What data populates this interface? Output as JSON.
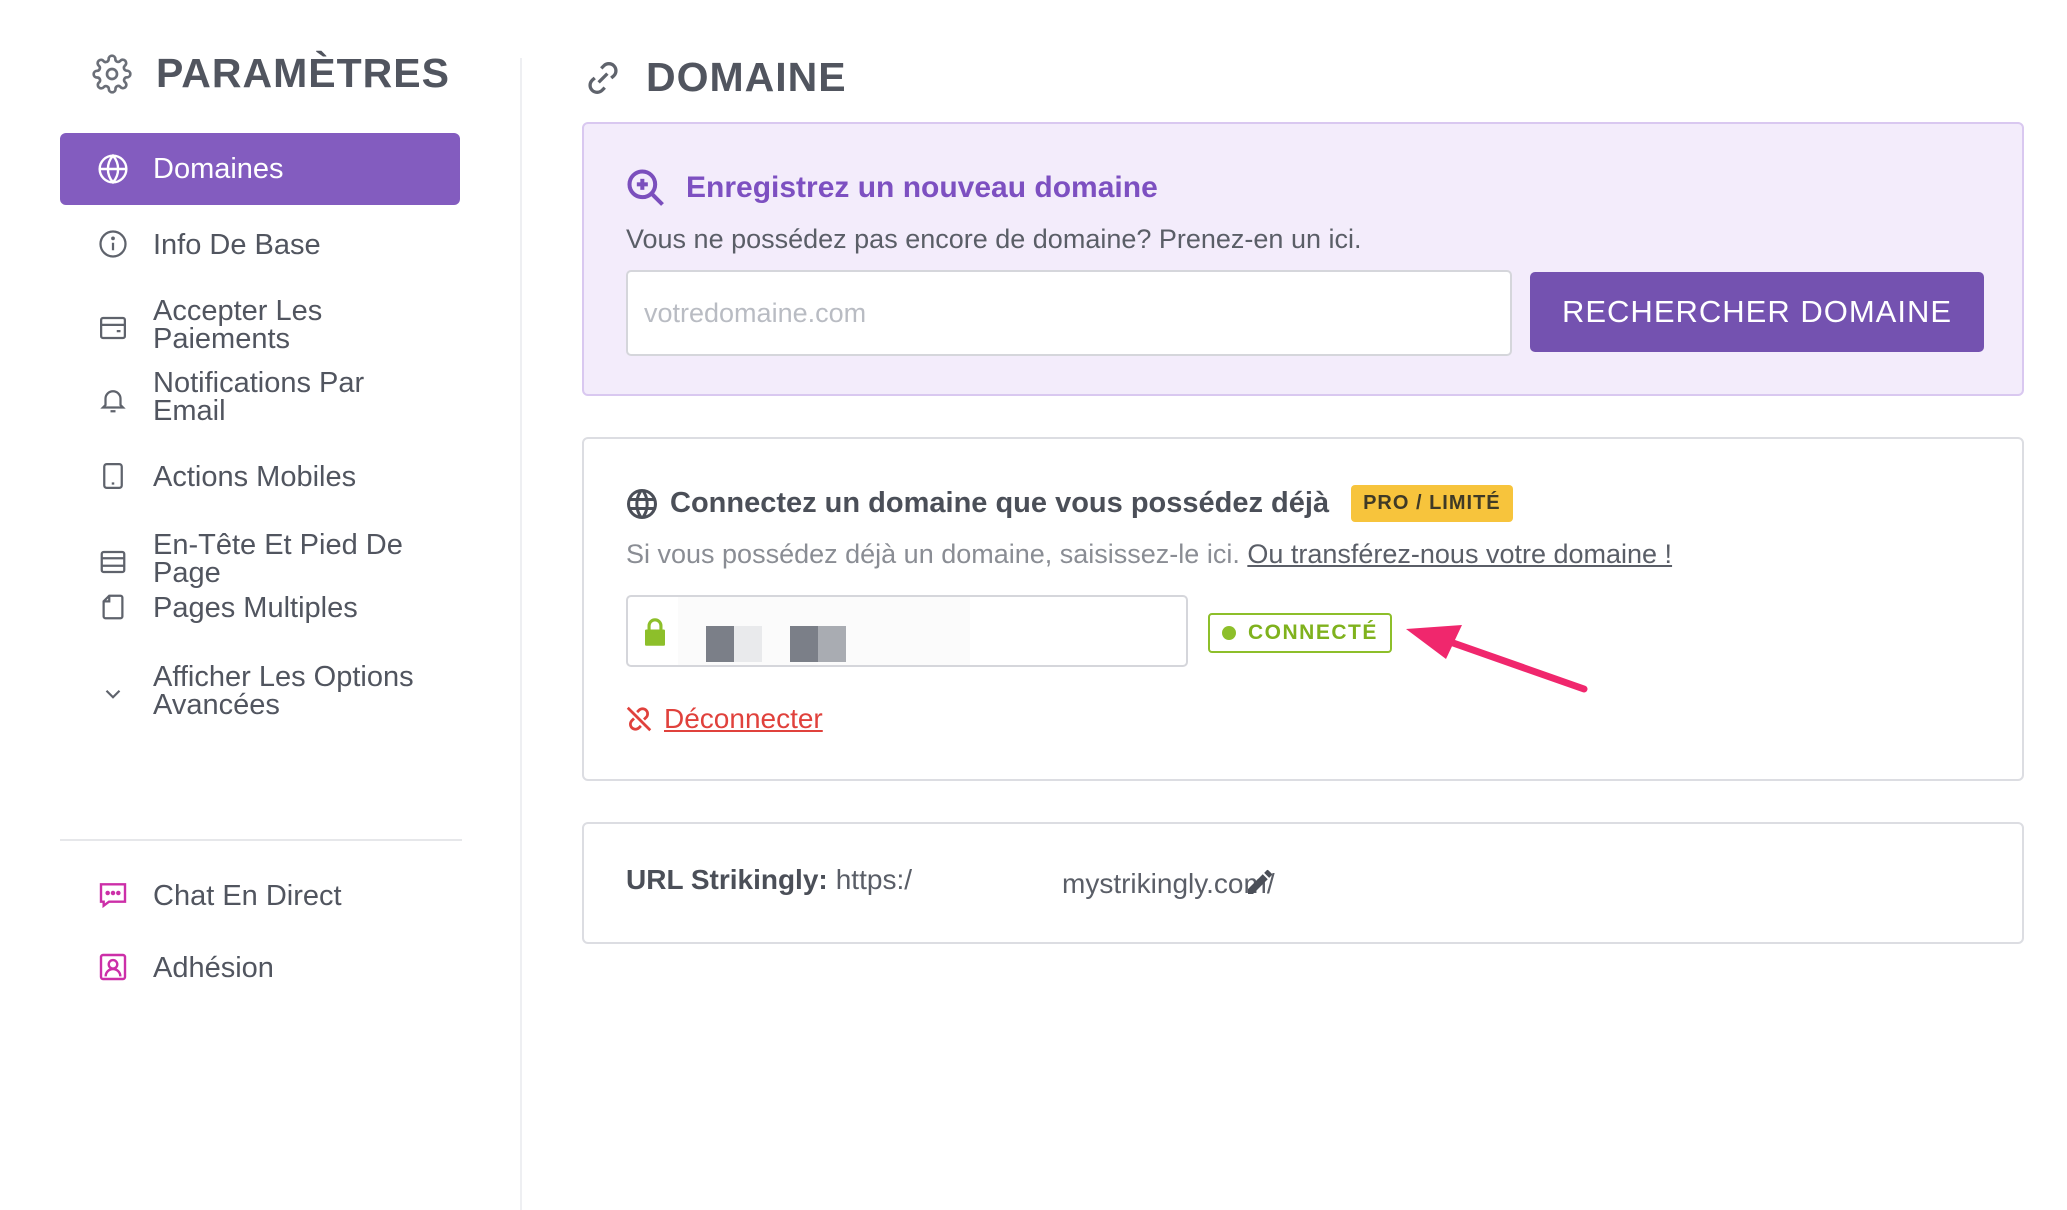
{
  "sidebar": {
    "title": "PARAMÈTRES",
    "items": [
      {
        "label": "Domaines",
        "icon": "globe-icon"
      },
      {
        "label": "Info De Base",
        "icon": "info-icon"
      },
      {
        "label": "Accepter Les\nPaiements",
        "icon": "wallet-icon"
      },
      {
        "label": "Notifications Par\nEmail",
        "icon": "bell-icon"
      },
      {
        "label": "Actions Mobiles",
        "icon": "tablet-icon"
      },
      {
        "label": "En-Tête Et Pied De\nPage",
        "icon": "layout-icon"
      },
      {
        "label": "Pages Multiples",
        "icon": "pages-icon"
      },
      {
        "label": "Afficher Les Options\nAvancées",
        "icon": "chevron-down-icon"
      },
      {
        "label": "Chat En Direct",
        "icon": "chat-icon"
      },
      {
        "label": "Adhésion",
        "icon": "member-icon"
      }
    ]
  },
  "main": {
    "title": "DOMAINE",
    "register": {
      "heading": "Enregistrez un nouveau domaine",
      "subtitle": "Vous ne possédez pas encore de domaine? Prenez-en un ici.",
      "placeholder": "votredomaine.com",
      "button": "RECHERCHER DOMAINE"
    },
    "connect": {
      "heading": "Connectez un domaine que vous possédez déjà",
      "badge": "PRO / LIMITÉ",
      "subtitle": "Si vous possédez déjà un domaine, saisissez-le ici.",
      "transfer_link": "Ou transférez-nous votre domaine !",
      "status": "CONNECTÉ",
      "disconnect": "Déconnecter"
    },
    "url": {
      "label": "URL Strikingly:",
      "prefix": "https:/",
      "suffix": "mystrikingly.com/"
    }
  },
  "colors": {
    "accent": "#835cbf",
    "button": "#7452b0",
    "connected": "#8dbf2a",
    "badge": "#f7c43c",
    "danger": "#e0413c",
    "arrow": "#f0276d",
    "pink_icons": "#cc2fa8"
  }
}
